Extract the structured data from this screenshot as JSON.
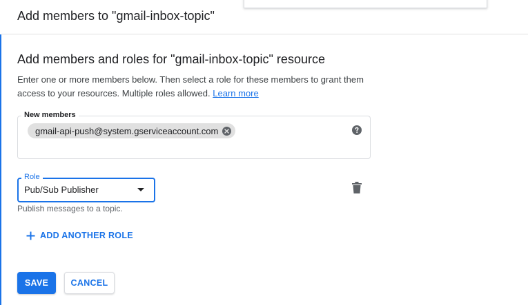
{
  "panel": {
    "title": "Add members to \"gmail-inbox-topic\""
  },
  "section": {
    "title": "Add members and roles for \"gmail-inbox-topic\" resource",
    "description": "Enter one or more members below. Then select a role for these members to grant them access to your resources. Multiple roles allowed.",
    "learn_more": "Learn more"
  },
  "members": {
    "label": "New members",
    "chips": [
      {
        "text": "gmail-api-push@system.gserviceaccount.com"
      }
    ]
  },
  "role": {
    "label": "Role",
    "selected": "Pub/Sub Publisher",
    "hint": "Publish messages to a topic."
  },
  "add_role_label": "ADD ANOTHER ROLE",
  "buttons": {
    "save": "SAVE",
    "cancel": "CANCEL"
  },
  "colors": {
    "accent": "#1a73e8",
    "chip_bg": "#e0e0e0",
    "icon_gray": "#5f6368"
  },
  "icons": {
    "chip_remove": "close-circle-icon",
    "help": "help-circle-icon",
    "delete": "trash-icon",
    "add": "plus-icon",
    "dropdown": "dropdown-arrow-icon"
  }
}
